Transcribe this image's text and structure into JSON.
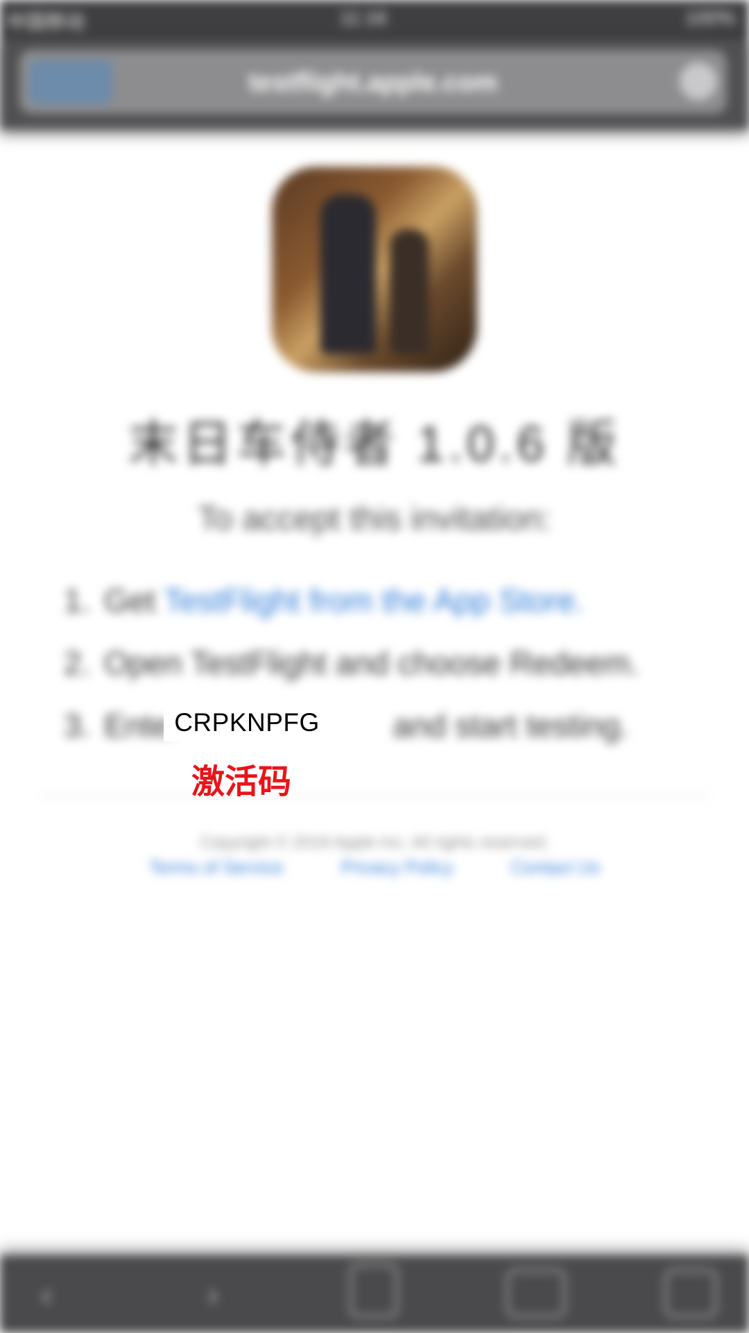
{
  "status_bar": {
    "carrier": "中国移动",
    "time": "11:16",
    "battery": "100%"
  },
  "browser": {
    "url": "testflight.apple.com"
  },
  "page": {
    "app_title": "末日车侍者 1.0.6 版",
    "invite_heading": "To accept this invitation:",
    "steps": [
      {
        "number": "1.",
        "text": "Get ",
        "link": "TestFlight from the App Store."
      },
      {
        "number": "2.",
        "text": "Open TestFlight and choose Redeem."
      },
      {
        "number": "3.",
        "text": "Enter                        and start testing."
      }
    ],
    "copyright": "Copyright © 2019 Apple Inc. All rights reserved.",
    "footer_links": [
      "Terms of Service",
      "Privacy Policy",
      "Contact Us"
    ]
  },
  "overlay": {
    "code": "CRPKNPFG",
    "caption": "激活码",
    "caption_color": "#e8141a"
  },
  "toolbar": {
    "back_icon": "back-arrow-icon",
    "forward_icon": "forward-arrow-icon",
    "share_icon": "share-icon",
    "bookmarks_icon": "bookmarks-icon",
    "tabs_icon": "tabs-icon"
  }
}
